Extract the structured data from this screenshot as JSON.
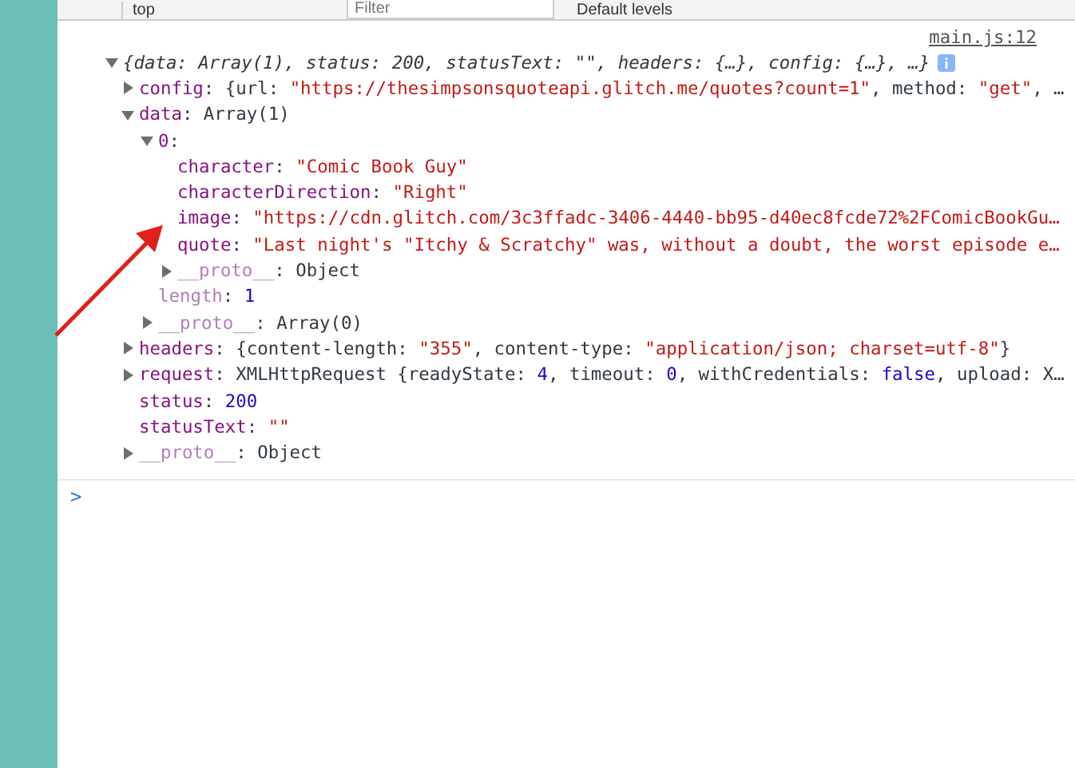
{
  "toolbar": {
    "context": "top",
    "filter": {
      "placeholder": "Filter"
    },
    "levels": "Default levels"
  },
  "message": {
    "source": "main.js:12",
    "root": {
      "expanded": true,
      "summary": "{data: Array(1), status: 200, statusText: \"\", headers: {…}, config: {…}, …}",
      "children": [
        {
          "key": "config",
          "expanded": false,
          "dim": false,
          "value": [
            {
              "kind": "plain",
              "text": ": {url: "
            },
            {
              "kind": "string",
              "text": "\"https://thesimpsonsquoteapi.glitch.me/quotes?count=1\""
            },
            {
              "kind": "plain",
              "text": ", method: "
            },
            {
              "kind": "string",
              "text": "\"get\""
            },
            {
              "kind": "plain",
              "text": ", …"
            }
          ]
        },
        {
          "key": "data",
          "expanded": true,
          "dim": false,
          "value": [
            {
              "kind": "plain",
              "text": ": Array(1)"
            }
          ],
          "children": [
            {
              "key": "0",
              "expanded": true,
              "dim": false,
              "value": [
                {
                  "kind": "plain",
                  "text": ":"
                }
              ],
              "children": [
                {
                  "key": "character",
                  "dim": false,
                  "value": [
                    {
                      "kind": "plain",
                      "text": ": "
                    },
                    {
                      "kind": "string",
                      "text": "\"Comic Book Guy\""
                    }
                  ]
                },
                {
                  "key": "characterDirection",
                  "dim": false,
                  "value": [
                    {
                      "kind": "plain",
                      "text": ": "
                    },
                    {
                      "kind": "string",
                      "text": "\"Right\""
                    }
                  ]
                },
                {
                  "key": "image",
                  "dim": false,
                  "value": [
                    {
                      "kind": "plain",
                      "text": ": "
                    },
                    {
                      "kind": "string",
                      "text": "\"https://cdn.glitch.com/3c3ffadc-3406-4440-bb95-d40ec8fcde72%2FComicBookGu…"
                    }
                  ]
                },
                {
                  "key": "quote",
                  "dim": false,
                  "value": [
                    {
                      "kind": "plain",
                      "text": ": "
                    },
                    {
                      "kind": "string",
                      "text": "\"Last night's \"Itchy & Scratchy\" was, without a doubt, the worst episode e…"
                    }
                  ]
                },
                {
                  "key": "__proto__",
                  "expanded": false,
                  "dim": true,
                  "value": [
                    {
                      "kind": "plain",
                      "text": ": Object"
                    }
                  ]
                }
              ]
            },
            {
              "key": "length",
              "dim": true,
              "value": [
                {
                  "kind": "plain",
                  "text": ": "
                },
                {
                  "kind": "number",
                  "text": "1"
                }
              ]
            },
            {
              "key": "__proto__",
              "expanded": false,
              "dim": true,
              "value": [
                {
                  "kind": "plain",
                  "text": ": Array(0)"
                }
              ]
            }
          ]
        },
        {
          "key": "headers",
          "expanded": false,
          "dim": false,
          "value": [
            {
              "kind": "plain",
              "text": ": {content-length: "
            },
            {
              "kind": "string",
              "text": "\"355\""
            },
            {
              "kind": "plain",
              "text": ", content-type: "
            },
            {
              "kind": "string",
              "text": "\"application/json; charset=utf-8\""
            },
            {
              "kind": "plain",
              "text": "}"
            }
          ]
        },
        {
          "key": "request",
          "expanded": false,
          "dim": false,
          "value": [
            {
              "kind": "plain",
              "text": ": XMLHttpRequest {readyState: "
            },
            {
              "kind": "number",
              "text": "4"
            },
            {
              "kind": "plain",
              "text": ", timeout: "
            },
            {
              "kind": "number",
              "text": "0"
            },
            {
              "kind": "plain",
              "text": ", withCredentials: "
            },
            {
              "kind": "number",
              "text": "false"
            },
            {
              "kind": "plain",
              "text": ", upload: X…"
            }
          ]
        },
        {
          "key": "status",
          "dim": false,
          "value": [
            {
              "kind": "plain",
              "text": ": "
            },
            {
              "kind": "number",
              "text": "200"
            }
          ]
        },
        {
          "key": "statusText",
          "dim": false,
          "value": [
            {
              "kind": "plain",
              "text": ": "
            },
            {
              "kind": "string",
              "text": "\"\""
            }
          ]
        },
        {
          "key": "__proto__",
          "expanded": false,
          "dim": true,
          "value": [
            {
              "kind": "plain",
              "text": ": Object"
            }
          ]
        }
      ]
    }
  },
  "prompt": ">"
}
